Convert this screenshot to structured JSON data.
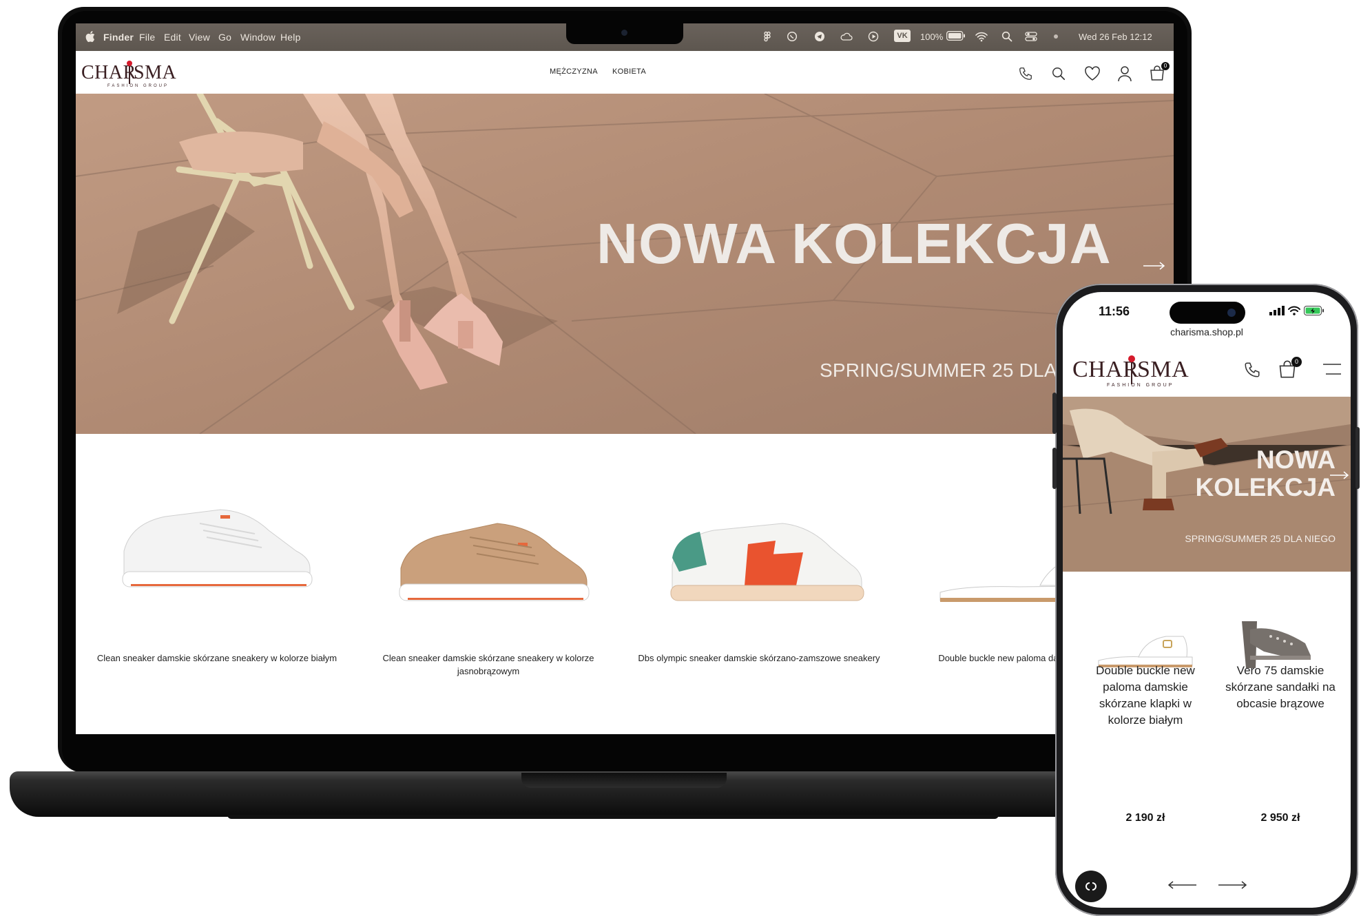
{
  "menubar": {
    "items": [
      "Finder",
      "File",
      "Edit",
      "View",
      "Go",
      "Window",
      "Help"
    ],
    "battery": "100%",
    "vk_label": "VK",
    "datetime": "Wed 26 Feb  12:12"
  },
  "site": {
    "logo_text": "CHAR SMA",
    "logo_left": "CHAR",
    "logo_right": "SMA",
    "logo_tagline": "FASHION GROUP",
    "nav": [
      "MĘŻCZYZNA",
      "KOBIETA"
    ],
    "cart_count": "0",
    "icons": [
      "phone-icon",
      "search-icon",
      "heart-icon",
      "user-icon",
      "cart-icon"
    ]
  },
  "hero": {
    "title": "NOWA KOLEKCJA",
    "subtitle": "SPRING/SUMMER 25 DLA N"
  },
  "products": [
    {
      "name": "Clean sneaker damskie skórzane sneakery w kolorze białym"
    },
    {
      "name": "Clean sneaker damskie skórzane sneakery w kolorze jasnobrązowym"
    },
    {
      "name": "Dbs olympic sneaker damskie skórzano-zamszowe sneakery"
    },
    {
      "name": "Double buckle new paloma dams kolorze biały"
    }
  ],
  "phone": {
    "time": "11:56",
    "url": "charisma.shop.pl",
    "cart_count": "0",
    "hero_title_line1": "NOWA",
    "hero_title_line2": "KOLEKCJA",
    "hero_subtitle": "SPRING/SUMMER 25 DLA NIEGO",
    "products": [
      {
        "name": "Double buckle new paloma damskie skórzane klapki w kolorze białym",
        "price": "2 190 zł"
      },
      {
        "name": "Vero 75 damskie skórzane sandałki na obcasie brązowe",
        "price": "2 950 zł"
      }
    ]
  },
  "colors": {
    "brand_dot": "#d51a2b",
    "brand_text": "#3a1f22",
    "hero_bg": "#b8927a"
  }
}
